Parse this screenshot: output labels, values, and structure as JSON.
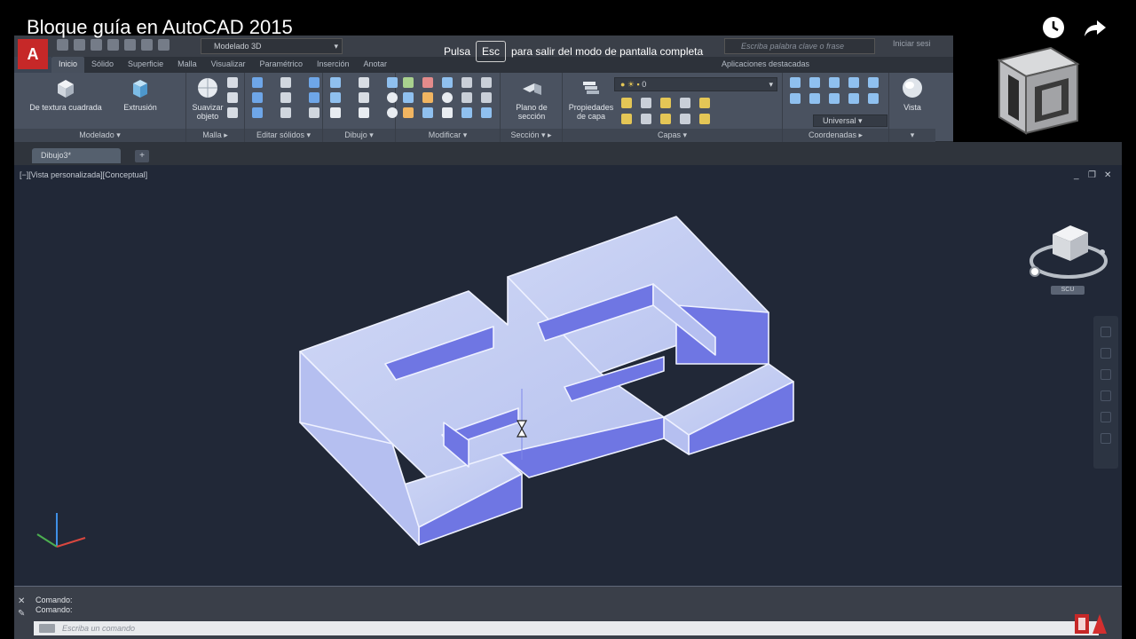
{
  "video": {
    "title": "Bloque guía en AutoCAD 2015"
  },
  "fullscreen_notice": {
    "before": "Pulsa",
    "key": "Esc",
    "after": "para salir del modo de pantalla completa"
  },
  "app_button": "A",
  "quick_access": {
    "workspace": "Modelado 3D"
  },
  "search": {
    "placeholder": "Escriba palabra clave o frase"
  },
  "login": "Iniciar sesi",
  "ribbon_tabs": [
    "Inicio",
    "Sólido",
    "Superficie",
    "Malla",
    "Visualizar",
    "Paramétrico",
    "Inserción",
    "Anotar"
  ],
  "ribbon_tab_right": "Aplicaciones destacadas",
  "panels": {
    "modelado": {
      "label": "Modelado",
      "buttons": [
        "De textura cuadrada",
        "Extrusión"
      ]
    },
    "malla": {
      "label": "Malla",
      "button": "Suavizar objeto"
    },
    "editar_solidos": {
      "label": "Editar sólidos"
    },
    "dibujo": {
      "label": "Dibujo"
    },
    "modificar": {
      "label": "Modificar"
    },
    "seccion": {
      "label": "Sección",
      "button": "Plano de sección"
    },
    "capas": {
      "label": "Capas",
      "button": "Propiedades de capa",
      "current_layer": "0"
    },
    "coordenadas": {
      "label": "Coordenadas",
      "ucs": "Universal"
    },
    "vista": {
      "button": "Vista"
    }
  },
  "file_tab": "Dibujo3*",
  "file_tab_add": "+",
  "viewport": {
    "label": "[−][Vista personalizada][Conceptual]",
    "controls": [
      "_",
      "❐",
      "✕"
    ],
    "wcs": "SCU"
  },
  "command_line": {
    "history": [
      "Comando:",
      "Comando:"
    ],
    "placeholder": "Escriba un comando"
  },
  "colors": {
    "viewport_bg": "#212837",
    "model_top": "#c3cdf0",
    "model_front": "#b5bff0",
    "model_side": "#6f76e3",
    "edge": "#eef1ff"
  }
}
